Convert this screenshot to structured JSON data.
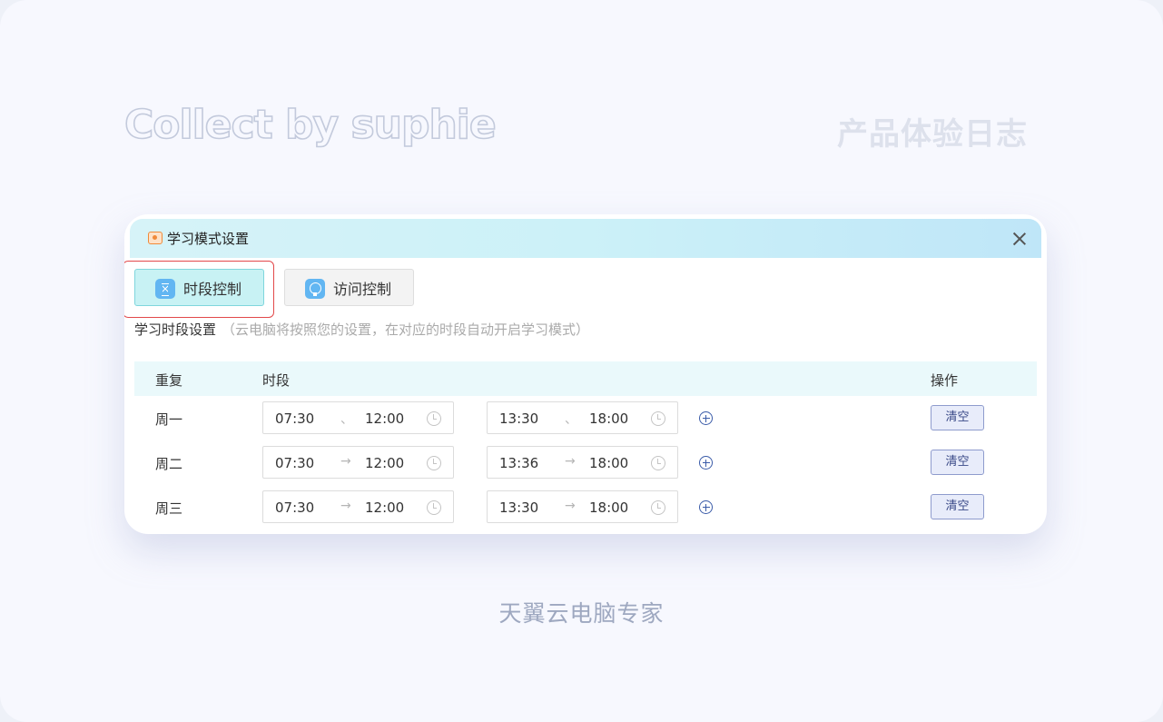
{
  "watermark": {
    "left": "Collect by suphie",
    "right": "产品体验日志",
    "caption": "天翼云电脑专家"
  },
  "dialog": {
    "title": "学习模式设置",
    "close_icon": "close-icon"
  },
  "tabs": [
    {
      "label": "时段控制",
      "icon": "hourglass-icon",
      "active": true
    },
    {
      "label": "访问控制",
      "icon": "globe-icon",
      "active": false
    }
  ],
  "section": {
    "title": "学习时段设置",
    "hint": "（云电脑将按照您的设置，在对应的时段自动开启学习模式）"
  },
  "table": {
    "headers": {
      "repeat": "重复",
      "period": "时段",
      "ops": "操作"
    },
    "rows": [
      {
        "day": "周一",
        "range1": {
          "start": "07:30",
          "sep": "、",
          "end": "12:00"
        },
        "range2": {
          "start": "13:30",
          "sep": "、",
          "end": "18:00"
        },
        "clear": "清空"
      },
      {
        "day": "周二",
        "range1": {
          "start": "07:30",
          "sep": "→",
          "end": "12:00"
        },
        "range2": {
          "start": "13:36",
          "sep": "→",
          "end": "18:00"
        },
        "clear": "清空"
      },
      {
        "day": "周三",
        "range1": {
          "start": "07:30",
          "sep": "→",
          "end": "12:00"
        },
        "range2": {
          "start": "13:30",
          "sep": "→",
          "end": "18:00"
        },
        "clear": "清空"
      }
    ]
  },
  "colors": {
    "accent": "#62b6f2",
    "highlight": "#e2484a",
    "active_tab": "#c8f2f4",
    "header_gradient": "#ccf1f8"
  }
}
